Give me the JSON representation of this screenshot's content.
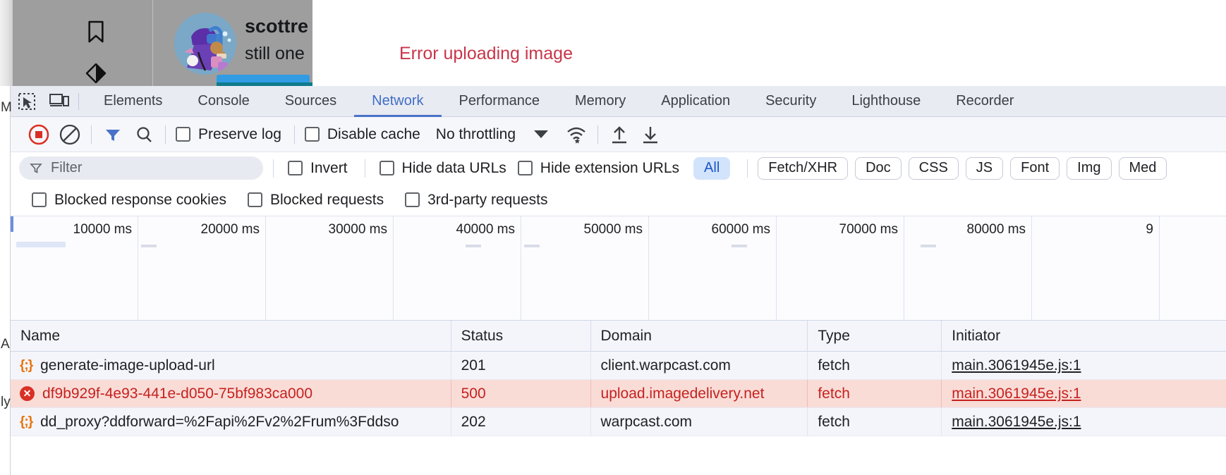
{
  "app": {
    "username": "scottre",
    "subtitle": "still one",
    "error_message": "Error uploading image",
    "error_color": "#c8354a",
    "bookmark_icon": "bookmark-icon",
    "diamond_icon": "diamond-half-icon"
  },
  "devtools": {
    "tabs": [
      {
        "label": "Elements",
        "active": false
      },
      {
        "label": "Console",
        "active": false
      },
      {
        "label": "Sources",
        "active": false
      },
      {
        "label": "Network",
        "active": true
      },
      {
        "label": "Performance",
        "active": false
      },
      {
        "label": "Memory",
        "active": false
      },
      {
        "label": "Application",
        "active": false
      },
      {
        "label": "Security",
        "active": false
      },
      {
        "label": "Lighthouse",
        "active": false
      },
      {
        "label": "Recorder",
        "active": false
      }
    ],
    "tab_icons": [
      "inspect-element-icon",
      "device-toolbar-icon"
    ],
    "active_tab_color": "#3f6ec4",
    "toolbar": {
      "record_icon": "record-stop-icon",
      "clear_icon": "clear-network-log-icon",
      "filter_icon": "filter-icon",
      "search_icon": "search-icon",
      "preserve_log_label": "Preserve log",
      "disable_cache_label": "Disable cache",
      "throttling_value": "No throttling",
      "network_conditions_icon": "wifi-settings-icon",
      "import_icon": "import-har-icon",
      "export_icon": "export-har-icon"
    },
    "filterbar": {
      "filter_placeholder": "Filter",
      "invert_label": "Invert",
      "hide_data_urls_label": "Hide data URLs",
      "hide_extension_urls_label": "Hide extension URLs",
      "type_chips": [
        "All",
        "Fetch/XHR",
        "Doc",
        "CSS",
        "JS",
        "Font",
        "Img",
        "Med"
      ],
      "selected_chip": "All"
    },
    "filterbar2": {
      "blocked_response_cookies_label": "Blocked response cookies",
      "blocked_requests_label": "Blocked requests",
      "third_party_requests_label": "3rd-party requests"
    },
    "overview": {
      "ticks": [
        "10000 ms",
        "20000 ms",
        "30000 ms",
        "40000 ms",
        "50000 ms",
        "60000 ms",
        "70000 ms",
        "80000 ms",
        "9"
      ]
    },
    "table": {
      "columns": [
        "Name",
        "Status",
        "Domain",
        "Type",
        "Initiator"
      ],
      "rows": [
        {
          "icon": "json-icon",
          "name": "generate-image-upload-url",
          "status": "201",
          "domain": "client.warpcast.com",
          "type": "fetch",
          "initiator": "main.3061945e.js:1",
          "error": false
        },
        {
          "icon": "error-icon",
          "name": "df9b929f-4e93-441e-d050-75bf983ca000",
          "status": "500",
          "domain": "upload.imagedelivery.net",
          "type": "fetch",
          "initiator": "main.3061945e.js:1",
          "error": true
        },
        {
          "icon": "json-icon",
          "name": "dd_proxy?ddforward=%2Fapi%2Fv2%2Frum%3Fddso",
          "status": "202",
          "domain": "warpcast.com",
          "type": "fetch",
          "initiator": "main.3061945e.js:1",
          "error": false
        }
      ]
    }
  },
  "edge_letters": [
    "M",
    "A",
    "ly"
  ]
}
